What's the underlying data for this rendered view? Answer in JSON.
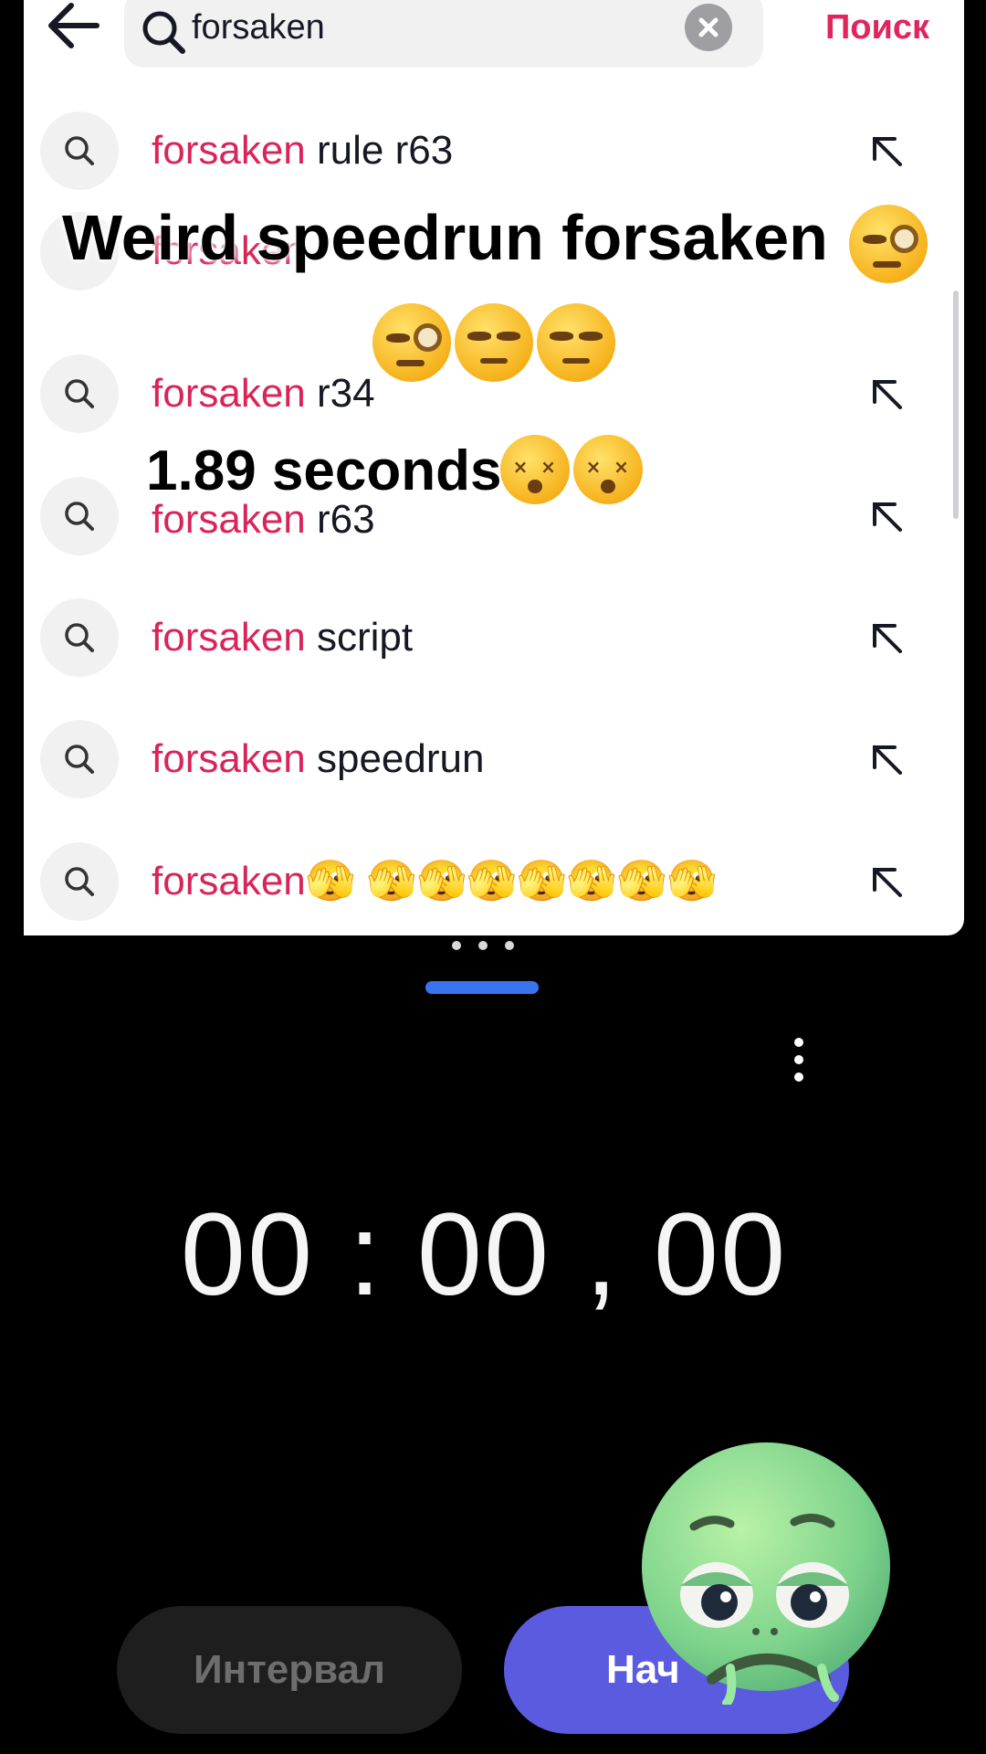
{
  "search_header": {
    "query": "forsaken",
    "submit_label": "Поиск",
    "back_icon": "arrow-left-icon",
    "search_icon": "search-icon",
    "clear_icon": "clear-icon"
  },
  "suggestions": [
    {
      "highlight": "forsaken",
      "rest": " rule r63"
    },
    {
      "highlight": "forsaken",
      "rest": ""
    },
    {
      "highlight": "forsaken",
      "rest": " r34"
    },
    {
      "highlight": "forsaken",
      "rest": " r63"
    },
    {
      "highlight": "forsaken",
      "rest": " script"
    },
    {
      "highlight": "forsaken",
      "rest": " speedrun"
    },
    {
      "highlight": "forsaken",
      "rest": "🫣 🫣🫣🫣🫣🫣🫣🫣"
    }
  ],
  "captions": {
    "title": "Weird speedrun forsaken",
    "time": "1.89 seconds"
  },
  "stopwatch": {
    "time": "00 : 00 , 00",
    "lap_label": "Интервал",
    "start_label": "Нач"
  },
  "colors": {
    "highlight": "#d9245a",
    "submit": "#e0245e",
    "start_button": "#5b5be0",
    "split_handle": "#3a73f0"
  }
}
